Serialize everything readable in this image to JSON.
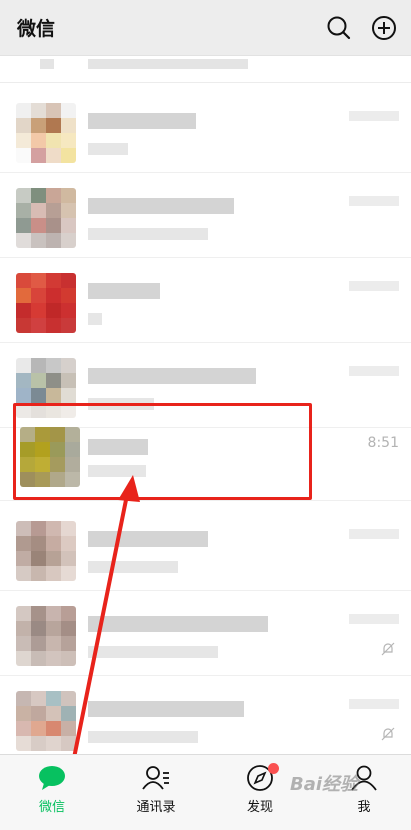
{
  "header": {
    "title": "微信",
    "search_icon": "search-icon",
    "add_icon": "plus-circle-icon"
  },
  "chats": [
    {
      "avatar_colors": [
        "#f0f0f0",
        "#e4ddd6",
        "#d8c4b6",
        "#f2f2f2",
        "#e2d6c8",
        "#c9a078",
        "#b07850",
        "#efe1c8",
        "#f4ead8",
        "#f3c9a8",
        "#f1e4b0",
        "#f6e8c0",
        "#fafafa",
        "#d4a0a0",
        "#efdcc8",
        "#f3e3a0"
      ],
      "time": "",
      "muted": false
    },
    {
      "avatar_colors": [
        "#c7cbc4",
        "#7f8f7e",
        "#c9a697",
        "#d0b9a0",
        "#a8b0a6",
        "#d8bcb4",
        "#b79f95",
        "#d6c3b0",
        "#8f9a92",
        "#c98f88",
        "#a9918a",
        "#d9c7c2",
        "#e0dcda",
        "#c9c2bf",
        "#bdb3b0",
        "#d8d0cc"
      ],
      "time": "",
      "muted": false
    },
    {
      "avatar_colors": [
        "#d94a3b",
        "#e05a45",
        "#d23a34",
        "#c83030",
        "#e26a3c",
        "#d8443a",
        "#cc2e2e",
        "#d23a30",
        "#c42c2c",
        "#d63a34",
        "#c02828",
        "#cc3030",
        "#c83834",
        "#d04040",
        "#c83030",
        "#c93a3a"
      ],
      "time": "",
      "muted": false
    },
    {
      "avatar_colors": [
        "#e9e9e9",
        "#b7b7b7",
        "#c8c8c8",
        "#d6d0cc",
        "#a3b7c2",
        "#b9c2a8",
        "#8e8f88",
        "#c7c0b6",
        "#9fb4c8",
        "#7b8a94",
        "#c8b89a",
        "#e0dcd4",
        "#ece9e6",
        "#e4e0dc",
        "#eae6e0",
        "#f0ece8"
      ],
      "time": "",
      "muted": false
    },
    {
      "avatar_colors": [
        "#b5ae86",
        "#aa9a3a",
        "#a39548",
        "#b3b09a",
        "#a69c28",
        "#b2a11e",
        "#9a9a5a",
        "#a9aa9c",
        "#b5a83a",
        "#bfae34",
        "#a59b5e",
        "#b1ad9d",
        "#9e8f5c",
        "#a89a58",
        "#b0a88a",
        "#bcb8a8"
      ],
      "time": "8:51",
      "muted": false
    },
    {
      "avatar_colors": [
        "#cdbdb8",
        "#b79a93",
        "#d0b8b0",
        "#e5d7d1",
        "#b09a90",
        "#a58d82",
        "#c6aca2",
        "#dccac2",
        "#c0aca4",
        "#9a8478",
        "#b7a296",
        "#d2c2ba",
        "#d6cac4",
        "#c8b7ae",
        "#d8c8c0",
        "#e6dad4"
      ],
      "time": "",
      "muted": false
    },
    {
      "avatar_colors": [
        "#d4c8c2",
        "#a6928a",
        "#c8b4ae",
        "#b89e96",
        "#c2b2aa",
        "#9a8a84",
        "#b8a59c",
        "#a48e86",
        "#c9bcb6",
        "#ad9c96",
        "#c8b6ae",
        "#b6a29a",
        "#ded6d0",
        "#c8bcb6",
        "#d2c4be",
        "#cdbfb8"
      ],
      "time": "",
      "muted": true
    },
    {
      "avatar_colors": [
        "#c6b7b2",
        "#d7c8c2",
        "#a8c0c4",
        "#d0c3bd",
        "#c9b2a4",
        "#c0a89e",
        "#d4c2b8",
        "#9fb2b4",
        "#d8b8b0",
        "#e0a890",
        "#d88870",
        "#c8b0a6",
        "#e6dcd6",
        "#d8ccc6",
        "#e0d4ce",
        "#d6c8c2"
      ],
      "time": "",
      "muted": true
    }
  ],
  "tabs": [
    {
      "label": "微信",
      "icon": "chat-bubble-icon",
      "active": true
    },
    {
      "label": "通讯录",
      "icon": "contacts-icon",
      "active": false
    },
    {
      "label": "发现",
      "icon": "compass-icon",
      "active": false,
      "badge": true
    },
    {
      "label": "我",
      "icon": "person-icon",
      "active": false
    }
  ],
  "watermark": "Bai经验",
  "colors": {
    "accent": "#07c160",
    "highlight_box": "#e8231b",
    "arrow": "#e8231b",
    "badge": "#fa5151"
  }
}
